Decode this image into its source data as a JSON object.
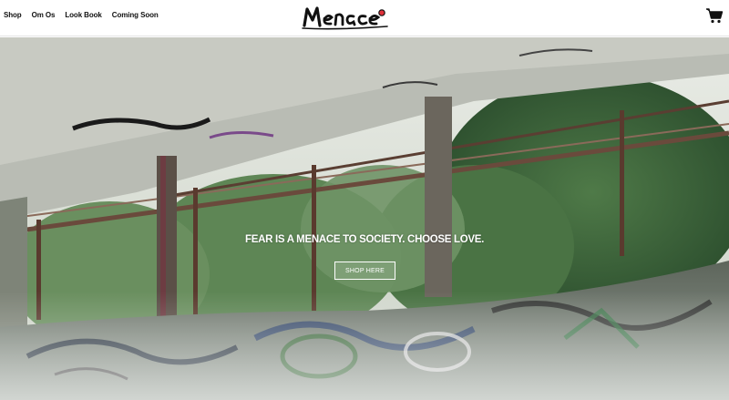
{
  "header": {
    "nav": [
      {
        "label": "Shop"
      },
      {
        "label": "Om Os"
      },
      {
        "label": "Look Book"
      },
      {
        "label": "Coming Soon"
      }
    ],
    "logo_text": "Menace",
    "cart_icon": "shopping-cart-icon"
  },
  "hero": {
    "tagline": "FEAR IS A MENACE TO SOCIETY. CHOOSE LOVE.",
    "button_label": "SHOP HERE"
  },
  "colors": {
    "nav_text": "#111111",
    "logo_accent": "#e0303a",
    "hero_text": "#ffffff"
  }
}
